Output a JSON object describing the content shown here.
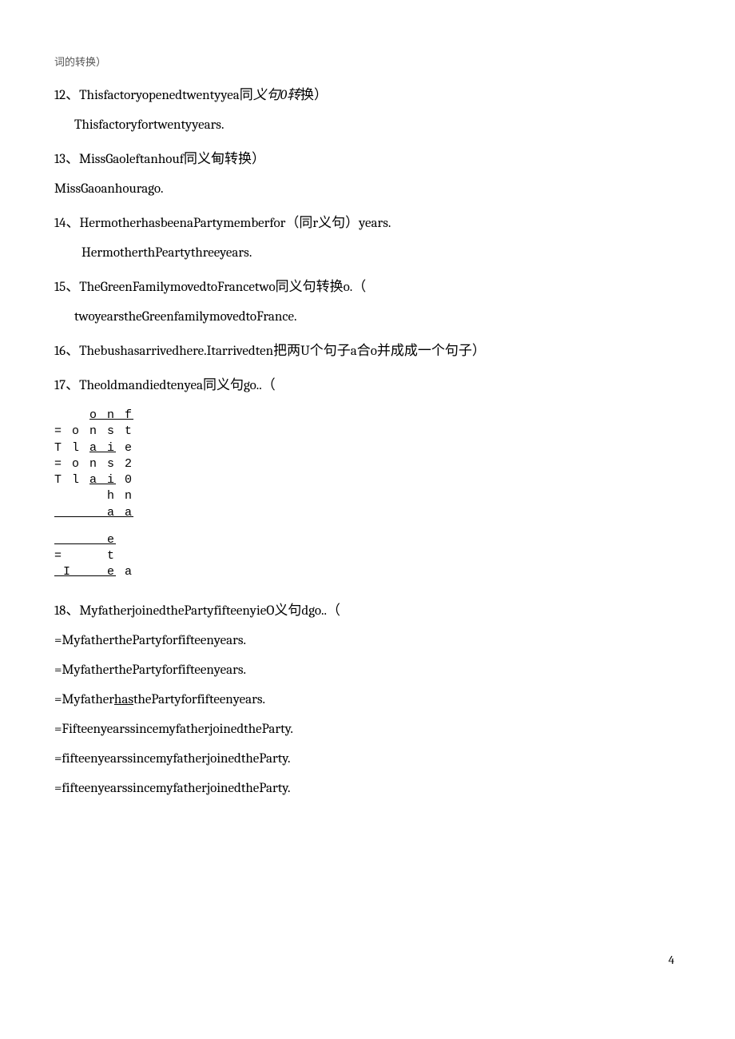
{
  "header_small": "词的转换）",
  "q12": {
    "main": "12、Thisfactoryopenedtwentyyea",
    "note_pre": "同",
    "note_ital1": "义句",
    "note_ital2": "0转",
    "note_post": "换）",
    "sub": "Thisfactoryfortwentyyears."
  },
  "q13": {
    "main": "13、MissGaoleftanhouf同义甸转换）",
    "sub": "MissGaoanhourago."
  },
  "q14": {
    "main": "14、HermotherhasbeenaPartymemberfor（同r义句）years.",
    "sub": "HermotherthPeartythreeyears."
  },
  "q15": {
    "main": "15、TheGreenFamilymovedtoFrancetwo同义句转换o.（",
    "sub": "twoyearstheGreenfamilymovedtoFrance."
  },
  "q16": {
    "main": "16、Thebushasarrivedhere.Itarrivedten把两U个句子a合o并成成一个句子）"
  },
  "q17": {
    "main": "17、Theoldmandiedtenyea同义句go..（",
    "b1_pre": "    ",
    "b1_u": "o n f",
    "b2": "= o n s t",
    "b3_pre": "T l ",
    "b3_u": "a i",
    "b3_post": " e",
    "b4": "= o n s 2",
    "b5_pre": "T l ",
    "b5_u": "a i",
    "b5_post": " 0",
    "b6": "      h n",
    "b7_pre": "      ",
    "b7_u": "a a",
    "b8_u": "      e",
    "b9": "=     t",
    "b10_pre": " ",
    "b10_u": "I    e",
    "b10_post": " a"
  },
  "q18": {
    "main": "18、MyfatherjoinedthePartyfifteenyieO义句dgo..（",
    "s1": "=MyfatherthePartyforfifteenyears.",
    "s2": "=MyfatherthePartyforfifteenyears.",
    "s3_pre": "=Myfather",
    "s3_u": "has",
    "s3_post": "thePartyforfifteenyears.",
    "s4": "=FifteenyearssincemyfatherjoinedtheParty.",
    "s5": "=fifteenyearssincemyfatherjoinedtheParty.",
    "s6": "=fifteenyearssincemyfatherjoinedtheParty."
  },
  "pagenum": "4"
}
